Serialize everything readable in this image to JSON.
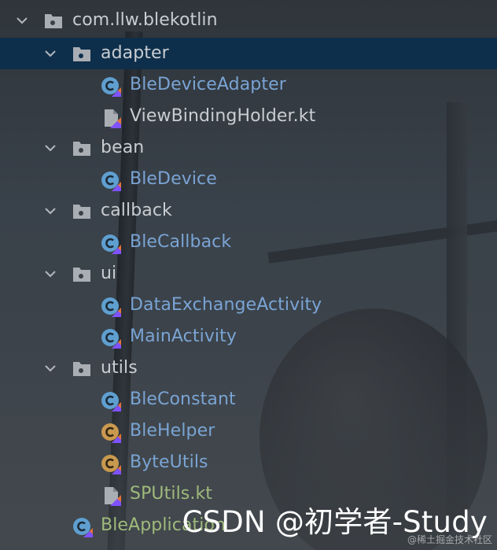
{
  "tree": {
    "root": {
      "label": "com.llw.blekotlin",
      "icon": "package-folder-icon"
    },
    "folders": [
      {
        "label": "adapter",
        "selected": true,
        "icon": "package-folder-icon",
        "children": [
          {
            "label": "BleDeviceAdapter",
            "icon": "kotlin-class-icon",
            "color": "#7aa4d4"
          },
          {
            "label": "ViewBindingHolder.kt",
            "icon": "kotlin-file-icon",
            "color": "#c9cdd2"
          }
        ]
      },
      {
        "label": "bean",
        "icon": "package-folder-icon",
        "children": [
          {
            "label": "BleDevice",
            "icon": "kotlin-class-icon",
            "color": "#7aa4d4"
          }
        ]
      },
      {
        "label": "callback",
        "icon": "package-folder-icon",
        "children": [
          {
            "label": "BleCallback",
            "icon": "kotlin-class-icon",
            "color": "#7aa4d4"
          }
        ]
      },
      {
        "label": "ui",
        "icon": "package-folder-icon",
        "children": [
          {
            "label": "DataExchangeActivity",
            "icon": "kotlin-class-icon",
            "color": "#7aa4d4"
          },
          {
            "label": "MainActivity",
            "icon": "kotlin-class-icon",
            "color": "#7aa4d4"
          }
        ]
      },
      {
        "label": "utils",
        "icon": "package-folder-icon",
        "children": [
          {
            "label": "BleConstant",
            "icon": "kotlin-class-icon",
            "color": "#7aa4d4"
          },
          {
            "label": "BleHelper",
            "icon": "kotlin-object-icon",
            "color": "#7aa4d4"
          },
          {
            "label": "ByteUtils",
            "icon": "kotlin-object-icon",
            "color": "#7aa4d4"
          },
          {
            "label": "SPUtils.kt",
            "icon": "kotlin-file-icon",
            "color": "#9fba7c"
          }
        ]
      }
    ],
    "app_file": {
      "label": "BleApplication",
      "icon": "kotlin-class-icon",
      "color": "#9fba7c"
    }
  },
  "watermark": {
    "text": "CSDN @初学者-Study",
    "sub": "@稀土掘金技术社区"
  },
  "colors": {
    "selection": "#0e2f4b",
    "default_text": "#c9cdd2",
    "kotlin_class_text": "#7aa4d4",
    "modified_text": "#9fba7c",
    "class_icon": "#5f9fd0",
    "object_icon": "#c8994f"
  }
}
